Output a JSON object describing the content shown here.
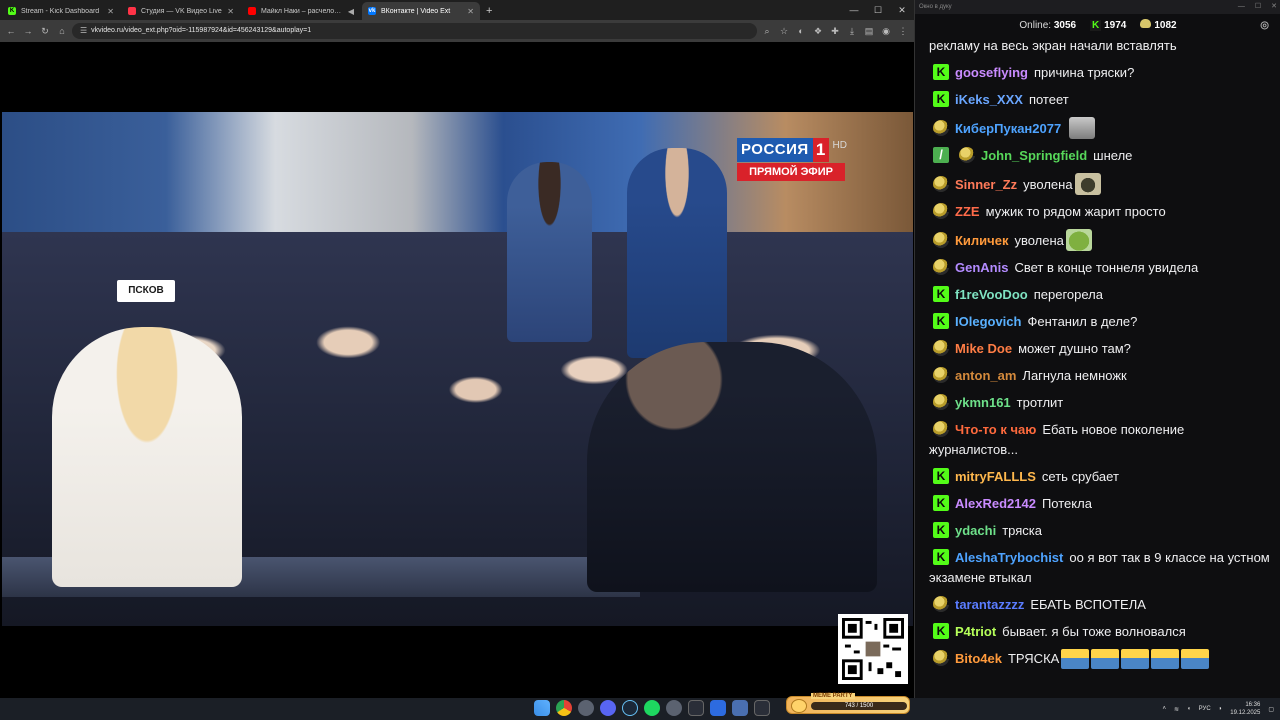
{
  "browser": {
    "tabs": [
      {
        "title": "Stream - Kick Dashboard",
        "favicon": "kick-icon",
        "color": "#53fc18"
      },
      {
        "title": "Студия — VK Видео Live",
        "favicon": "vk-live-icon",
        "color": "#ff3347"
      },
      {
        "title": "Майкл Наки – расчеловечива",
        "favicon": "youtube-icon",
        "color": "#ff0000"
      },
      {
        "title": "ВКонтакте | Video Ext",
        "favicon": "vk-icon",
        "color": "#0077ff"
      }
    ],
    "url": "vkvideo.ru/video_ext.php?oid=-115987924&id=456243129&autoplay=1"
  },
  "video": {
    "channel_logo": "РОССИЯ",
    "channel_number": "1",
    "hd_label": "HD",
    "live_label": "ПРЯМОЙ ЭФИР",
    "sign_text": "ПСКОВ",
    "colors": {
      "channel_blue": "#1f5bb0",
      "channel_red": "#d9222a"
    }
  },
  "chat": {
    "window_title": "Окно в дуку",
    "online_label": "Online:",
    "online_count": "3056",
    "kick_count": "1974",
    "coin_count": "1082",
    "messages": [
      {
        "badge": "",
        "user": "",
        "text": "рекламу на весь экран начали вставлять",
        "color": "#efeff1"
      },
      {
        "badge": "kick",
        "user": "gooseflying",
        "text": "причина тряски?",
        "color": "#c98bff"
      },
      {
        "badge": "kick",
        "user": "iKeks_XXX",
        "text": "потеет",
        "color": "#6aa6ff"
      },
      {
        "badge": "pepe",
        "user": "КиберПукан2077",
        "text": "",
        "emote": "face",
        "color": "#4ea3ff"
      },
      {
        "badge": "mod",
        "badge2": "pepe",
        "user": "John_Springfield",
        "text": "шнеле",
        "color": "#57d85a"
      },
      {
        "badge": "pepe",
        "user": "Sinner_Zz",
        "text": "уволена",
        "emote": "dark",
        "color": "#ff7a59"
      },
      {
        "badge": "pepe",
        "user": "ZZE",
        "text": "мужик то рядом жарит просто",
        "color": "#ff6b4a"
      },
      {
        "badge": "pepe",
        "user": "Киличек",
        "text": "уволена",
        "emote": "pepe",
        "color": "#ff9a3c"
      },
      {
        "badge": "pepe",
        "user": "GenAnis",
        "text": "Свет в конце тоннеля увидела",
        "color": "#b38bff"
      },
      {
        "badge": "kick",
        "user": "f1reVooDoo",
        "text": "перегорела",
        "color": "#7fe3c2"
      },
      {
        "badge": "kick",
        "user": "IOlegovich",
        "text": "Фентанил в деле?",
        "color": "#5ab1ff"
      },
      {
        "badge": "pepe",
        "user": "Mike Doe",
        "text": "может душно там?",
        "color": "#ff7d45"
      },
      {
        "badge": "pepe",
        "user": "anton_am",
        "text": "Лагнула немножк",
        "color": "#d48a3c"
      },
      {
        "badge": "pepe",
        "user": "ykmn161",
        "text": "тротлит",
        "color": "#6ee08a"
      },
      {
        "badge": "pepe",
        "user": "Что-то к чаю",
        "text": "Ебать новое поколение журналистов...",
        "color": "#ff6a3d"
      },
      {
        "badge": "kick",
        "user": "mitryFALLLS",
        "text": "сеть срубает",
        "color": "#ffb84d"
      },
      {
        "badge": "kick",
        "user": "AlexRed2142",
        "text": "Потекла",
        "color": "#c98bff"
      },
      {
        "badge": "kick",
        "user": "ydachi",
        "text": "тряска",
        "color": "#6ee08a"
      },
      {
        "badge": "kick",
        "user": "AleshaTrybochist",
        "text": "оо я вот так в 9 классе на устном экзамене втыкал",
        "color": "#4ea3ff"
      },
      {
        "badge": "pepe",
        "user": "tarantazzzz",
        "text": "ЕБАТЬ ВСПОТЕЛА",
        "color": "#5a7cff"
      },
      {
        "badge": "kick",
        "user": "P4triot",
        "text": "бывает. я бы тоже волновался",
        "color": "#b6ff5a"
      },
      {
        "badge": "pepe",
        "user": "Bito4ek",
        "text": "ТРЯСКА",
        "emote": "tr5",
        "color": "#ff9a3c"
      }
    ]
  },
  "taskbar": {
    "meme_title": "MEME PARTY",
    "meme_progress": "743 / 1500",
    "lang": "РУС",
    "time": "16:36",
    "date": "19.12.2025"
  }
}
